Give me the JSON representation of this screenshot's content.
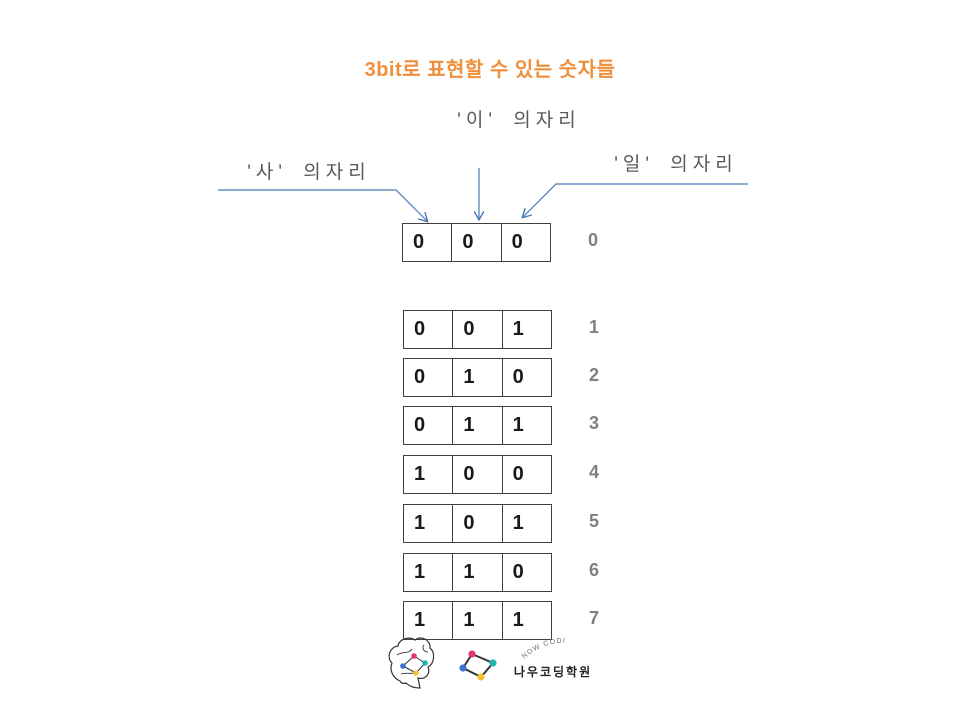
{
  "title": "3bit로 표현할 수 있는 숫자들",
  "place_labels": {
    "four": "'사' 의자리",
    "two": "'이' 의자리",
    "one": "'일' 의자리"
  },
  "start_row": {
    "bits": [
      "0",
      "0",
      "0"
    ],
    "value": "0"
  },
  "rows": [
    {
      "bits": [
        "0",
        "0",
        "1"
      ],
      "value": "1"
    },
    {
      "bits": [
        "0",
        "1",
        "0"
      ],
      "value": "2"
    },
    {
      "bits": [
        "0",
        "1",
        "1"
      ],
      "value": "3"
    },
    {
      "bits": [
        "1",
        "0",
        "0"
      ],
      "value": "4"
    },
    {
      "bits": [
        "1",
        "0",
        "1"
      ],
      "value": "5"
    },
    {
      "bits": [
        "1",
        "1",
        "0"
      ],
      "value": "6"
    },
    {
      "bits": [
        "1",
        "1",
        "1"
      ],
      "value": "7"
    }
  ],
  "logo": {
    "arc_text": "NOW CODING",
    "name": "나우코딩학원",
    "icons": [
      "brain-icon",
      "node-graph-icon"
    ]
  },
  "colors": {
    "title": "#ef8f3a",
    "label": "#595959",
    "arrow": "#4a78b8",
    "value": "#808080",
    "digit": "#1a1a1a",
    "border": "#404040",
    "node_pink": "#e8356d",
    "node_teal": "#1fb5ad",
    "node_yellow": "#f2c12e",
    "node_blue": "#3f6fd1"
  }
}
